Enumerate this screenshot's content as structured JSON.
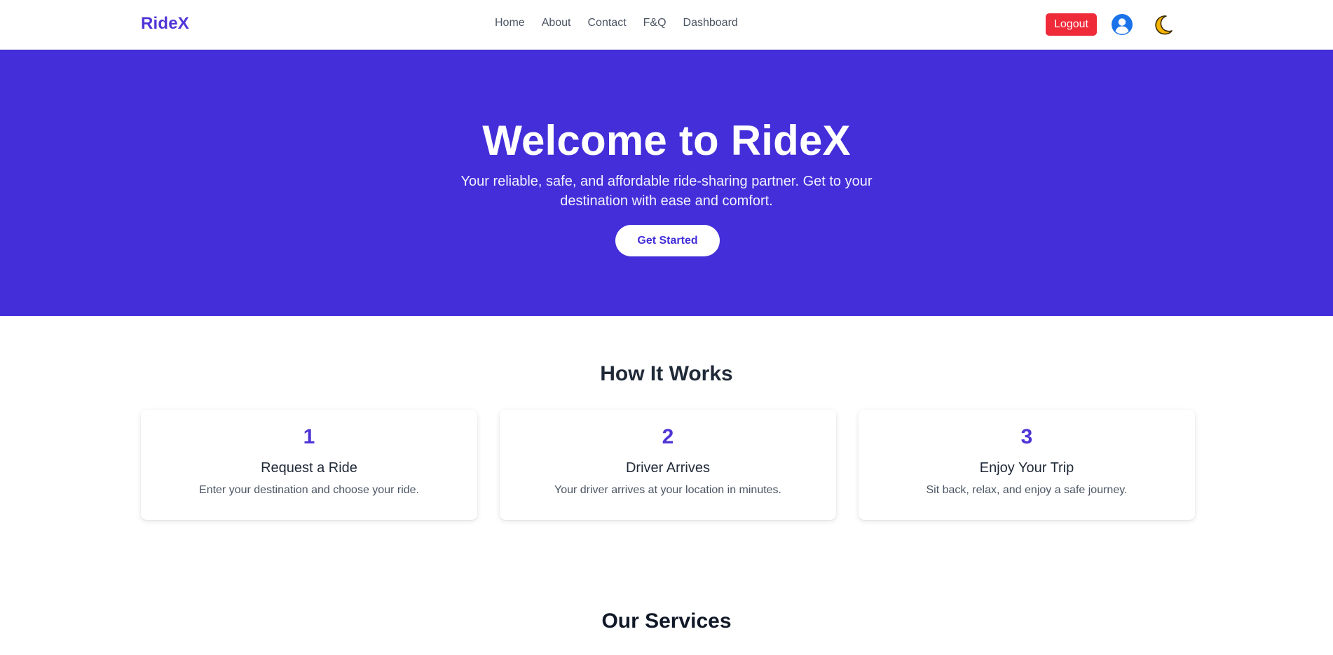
{
  "nav": {
    "brand": "RideX",
    "links": [
      "Home",
      "About",
      "Contact",
      "F&Q",
      "Dashboard"
    ],
    "logout_label": "Logout"
  },
  "hero": {
    "title": "Welcome to RideX",
    "subtitle": "Your reliable, safe, and affordable ride-sharing partner. Get to your destination with ease and comfort.",
    "cta_label": "Get Started"
  },
  "how": {
    "heading": "How It Works",
    "steps": [
      {
        "number": "1",
        "title": "Request a Ride",
        "desc": "Enter your destination and choose your ride."
      },
      {
        "number": "2",
        "title": "Driver Arrives",
        "desc": "Your driver arrives at your location in minutes."
      },
      {
        "number": "3",
        "title": "Enjoy Your Trip",
        "desc": "Sit back, relax, and enjoy a safe journey."
      }
    ]
  },
  "services": {
    "heading": "Our Services"
  },
  "colors": {
    "brand": "#4f35d6",
    "hero_bg": "#432ed9",
    "logout_bg": "#ef2b3a",
    "user_icon": "#1a73e8",
    "moon": "#f5b400"
  },
  "icons": {
    "user": "user-circle-icon",
    "theme": "moon-icon"
  }
}
